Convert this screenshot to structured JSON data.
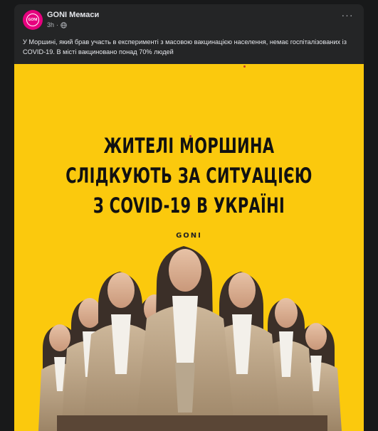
{
  "post": {
    "page_name": "GONI Мемаси",
    "avatar_text": "GONI",
    "time": "3h",
    "separator": "·",
    "more_label": "···",
    "caption": "У Моршині, який брав участь в експерименті з масовою вакцинацією населення, немає госпіталізованих із COVID-19. В місті вакциновано понад 70% людей"
  },
  "poster": {
    "line1": "ЖИТЕЛІ МОРШИНА",
    "line2": "СЛІДКУЮТЬ ЗА СИТУАЦІЄЮ",
    "line3": "З COVID-19 В УКРАЇНІ",
    "brand": "GONI",
    "background": "#fbc90d"
  },
  "colors": {
    "page_bg": "#18191a",
    "card_bg": "#242526",
    "primary_text": "#e4e6eb",
    "secondary_text": "#b0b3b8",
    "brand_pink": "#e6007e"
  }
}
